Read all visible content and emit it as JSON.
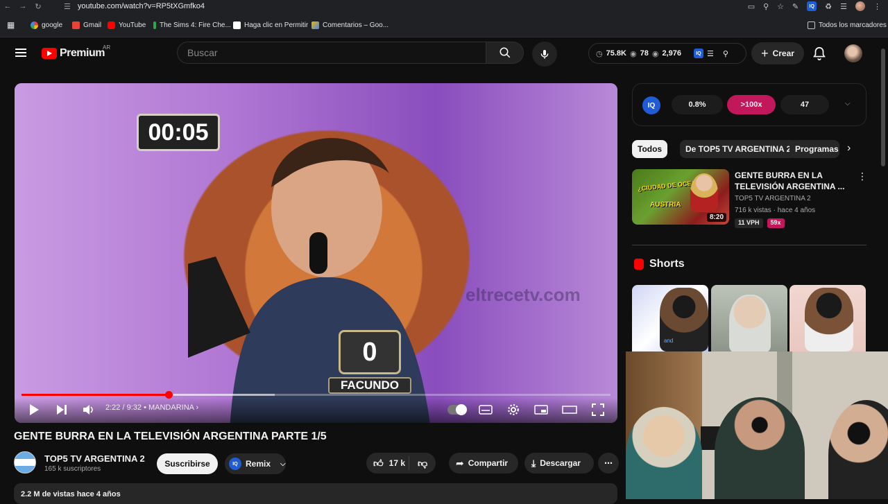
{
  "browser": {
    "url": "youtube.com/watch?v=RP5tXGmfko4",
    "bookmarks": [
      {
        "label": "google",
        "color": "#4285f4"
      },
      {
        "label": "Gmail",
        "color": "#ea4335"
      },
      {
        "label": "YouTube",
        "color": "#ff0000"
      },
      {
        "label": "The Sims 4: Fire Che...",
        "color": "#2aa84a"
      },
      {
        "label": "Haga clic en Permitir",
        "color": "#ffffff"
      },
      {
        "label": "Comentarios – Goo...",
        "color": "#f4b400"
      }
    ],
    "all_bookmarks": "Todos los marcadores"
  },
  "header": {
    "logo_text": "Premium",
    "country": "AR",
    "search_placeholder": "Buscar",
    "stats": {
      "views": "75.8K",
      "likes": "78",
      "watching": "2,976"
    },
    "create_label": "Crear"
  },
  "player": {
    "timer_overlay": "00:05",
    "score_overlay": "0",
    "contestant_name": "FACUNDO",
    "watermark": "eltrecetv.com",
    "progress": 0.25,
    "buffered": 0.43,
    "time": "2:22 / 9:32",
    "chapter": "MANDARINA"
  },
  "video": {
    "title": "GENTE BURRA EN LA TELEVISIÓN ARGENTINA PARTE 1/5",
    "channel": "TOP5 TV ARGENTINA 2",
    "subscribers": "165 k suscriptores",
    "subscribe_label": "Suscribirse",
    "remix_label": "Remix",
    "likes": "17 k",
    "share_label": "Compartir",
    "download_label": "Descargar",
    "views_date": "2.2 M de vistas  hace 4 años"
  },
  "sidebar": {
    "iq_stats": [
      "0.8%",
      ">100x",
      "47"
    ],
    "chips": [
      "Todos",
      "De TOP5 TV ARGENTINA 2",
      "Programas"
    ],
    "recommended": {
      "thumb_question": "¿CIUDAD DE OCEANÍA?",
      "thumb_answer": "AUSTRIA",
      "duration": "8:20",
      "title": "GENTE BURRA EN LA TELEVISIÓN ARGENTINA ...",
      "channel": "TOP5 TV ARGENTINA 2",
      "meta": "716 k vistas · hace 4 años",
      "vph": "11 VPH",
      "multiplier": "59x"
    },
    "shorts_title": "Shorts",
    "short_caption": "and"
  },
  "colors": {
    "accent": "#ff0000",
    "brand_pink": "#c2185b",
    "iq_blue": "#1f5cd6"
  }
}
